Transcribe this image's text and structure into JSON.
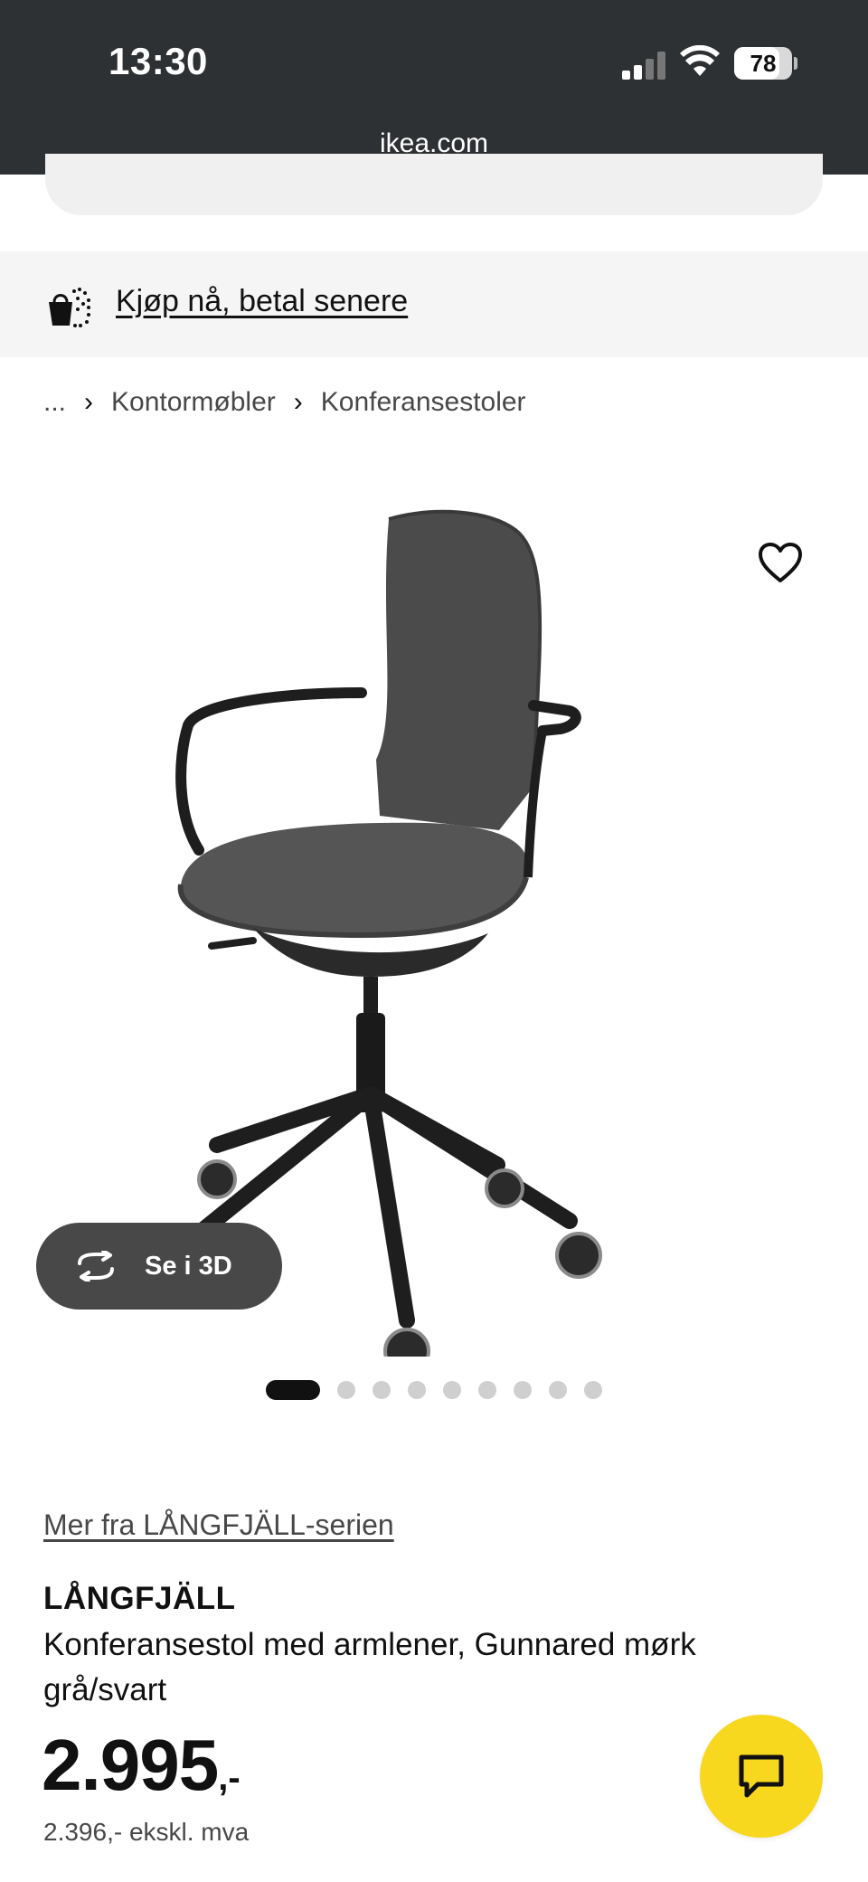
{
  "status_bar": {
    "time": "13:30",
    "battery": "78",
    "battery_level_pct": 78,
    "signal_bars": 2
  },
  "browser": {
    "url": "ikea.com"
  },
  "promo": {
    "link_text": "Kjøp nå, betal senere"
  },
  "breadcrumb": {
    "items": [
      "...",
      "Kontormøbler",
      "Konferansestoler"
    ]
  },
  "gallery": {
    "view_3d_label": "Se i 3D",
    "image_count": 9,
    "active_index": 0
  },
  "product": {
    "series_link": "Mer fra LÅNGFJÄLL-serien",
    "name": "LÅNGFJÄLL",
    "description": "Konferansestol med armlener, Gunnared mørk grå/svart",
    "price_main": "2.995",
    "price_suffix": ",-",
    "price_ex_vat": "2.396,- ekskl. mva"
  },
  "colors": {
    "brand_yellow": "#f8d71f",
    "statusbar_bg": "#2e3133",
    "button_dark": "#484848"
  },
  "icons": [
    "signal-icon",
    "wifi-icon",
    "battery-icon",
    "shopping-bag-icon",
    "chevron-right-icon",
    "heart-icon",
    "rotate-3d-icon",
    "chat-icon"
  ]
}
